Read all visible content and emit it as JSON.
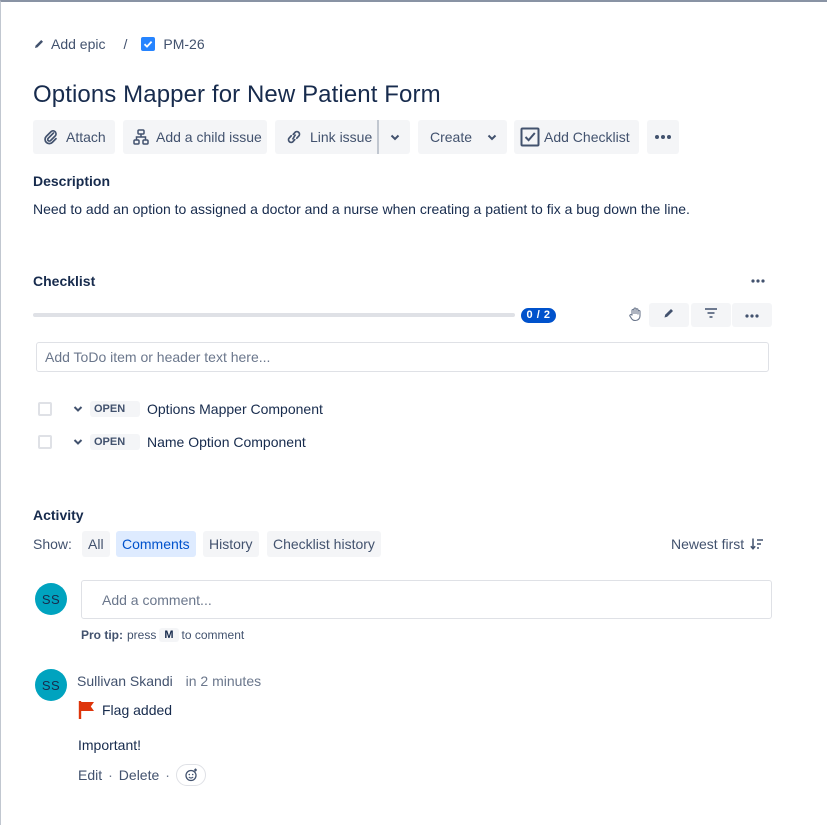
{
  "breadcrumb": {
    "epic_label": "Add epic",
    "separator": "/",
    "issue_key": "PM-26"
  },
  "issue": {
    "title": "Options Mapper for New Patient Form"
  },
  "toolbar": {
    "attach": "Attach",
    "add_child": "Add a child issue",
    "link_issue": "Link issue",
    "create": "Create",
    "add_checklist": "Add Checklist"
  },
  "description": {
    "label": "Description",
    "text": "Need to add an option to assigned a doctor and a nurse when creating a patient to fix a bug down the line."
  },
  "checklist": {
    "label": "Checklist",
    "progress_text": "0 / 2",
    "progress_fraction": 0,
    "input_placeholder": "Add ToDo item or header text here...",
    "items": [
      {
        "status": "OPEN",
        "text": "Options Mapper Component"
      },
      {
        "status": "OPEN",
        "text": "Name Option Component"
      }
    ]
  },
  "activity": {
    "label": "Activity",
    "show_label": "Show:",
    "filters": [
      "All",
      "Comments",
      "History",
      "Checklist history"
    ],
    "active_filter": "Comments",
    "sort_label": "Newest first",
    "comment_placeholder": "Add a comment...",
    "pro_tip": {
      "label": "Pro tip:",
      "press": "press",
      "key": "M",
      "suffix": "to comment"
    },
    "current_user_initials": "SS",
    "comments": [
      {
        "initials": "SS",
        "author": "Sullivan Skandi",
        "time": "in 2 minutes",
        "flag_text": "Flag added",
        "body": "Important!",
        "edit": "Edit",
        "delete": "Delete",
        "separator": "·"
      }
    ]
  },
  "colors": {
    "accent": "#0052CC",
    "avatar": "#00A3BF",
    "flag": "#DE350B",
    "checkbox_icon": "#2684FF"
  }
}
